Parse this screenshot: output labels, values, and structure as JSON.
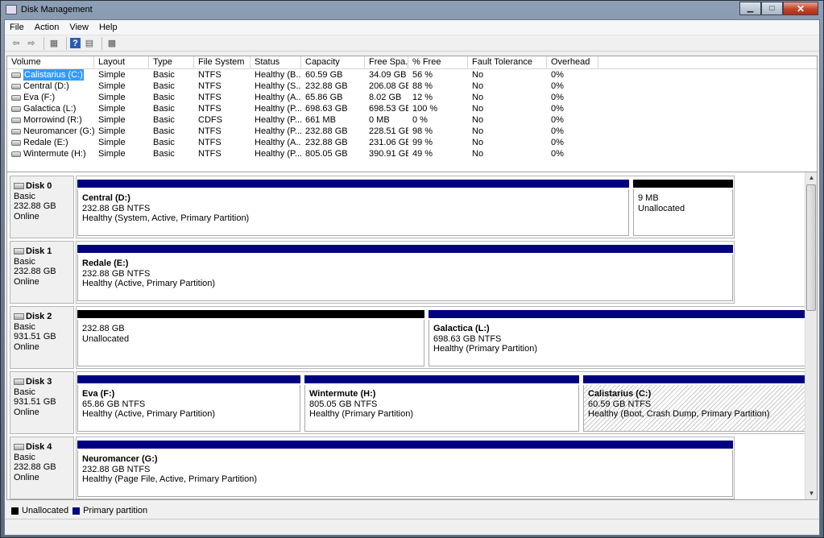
{
  "window": {
    "title": "Disk Management"
  },
  "menu": [
    "File",
    "Action",
    "View",
    "Help"
  ],
  "toolbar": {
    "icons": [
      "back-arrow-icon",
      "forward-arrow-icon",
      "properties-icon",
      "help-icon",
      "settings-icon"
    ]
  },
  "volume_list": {
    "headers": [
      "Volume",
      "Layout",
      "Type",
      "File System",
      "Status",
      "Capacity",
      "Free Spa...",
      "% Free",
      "Fault Tolerance",
      "Overhead"
    ],
    "rows": [
      {
        "volume": "Calistarius (C:)",
        "layout": "Simple",
        "type": "Basic",
        "fs": "NTFS",
        "status": "Healthy (B...",
        "capacity": "60.59 GB",
        "free": "34.09 GB",
        "pct": "56 %",
        "fault": "No",
        "overhead": "0%"
      },
      {
        "volume": "Central (D:)",
        "layout": "Simple",
        "type": "Basic",
        "fs": "NTFS",
        "status": "Healthy (S...",
        "capacity": "232.88 GB",
        "free": "206.08 GB",
        "pct": "88 %",
        "fault": "No",
        "overhead": "0%"
      },
      {
        "volume": "Eva (F:)",
        "layout": "Simple",
        "type": "Basic",
        "fs": "NTFS",
        "status": "Healthy (A...",
        "capacity": "65.86 GB",
        "free": "8.02 GB",
        "pct": "12 %",
        "fault": "No",
        "overhead": "0%"
      },
      {
        "volume": "Galactica (L:)",
        "layout": "Simple",
        "type": "Basic",
        "fs": "NTFS",
        "status": "Healthy (P...",
        "capacity": "698.63 GB",
        "free": "698.53 GB",
        "pct": "100 %",
        "fault": "No",
        "overhead": "0%"
      },
      {
        "volume": "Morrowind (R:)",
        "layout": "Simple",
        "type": "Basic",
        "fs": "CDFS",
        "status": "Healthy (P...",
        "capacity": "661 MB",
        "free": "0 MB",
        "pct": "0 %",
        "fault": "No",
        "overhead": "0%"
      },
      {
        "volume": "Neuromancer (G:)",
        "layout": "Simple",
        "type": "Basic",
        "fs": "NTFS",
        "status": "Healthy (P...",
        "capacity": "232.88 GB",
        "free": "228.51 GB",
        "pct": "98 %",
        "fault": "No",
        "overhead": "0%"
      },
      {
        "volume": "Redale (E:)",
        "layout": "Simple",
        "type": "Basic",
        "fs": "NTFS",
        "status": "Healthy (A...",
        "capacity": "232.88 GB",
        "free": "231.06 GB",
        "pct": "99 %",
        "fault": "No",
        "overhead": "0%"
      },
      {
        "volume": "Wintermute (H:)",
        "layout": "Simple",
        "type": "Basic",
        "fs": "NTFS",
        "status": "Healthy (P...",
        "capacity": "805.05 GB",
        "free": "390.91 GB",
        "pct": "49 %",
        "fault": "No",
        "overhead": "0%"
      }
    ]
  },
  "disks": [
    {
      "name": "Disk 0",
      "type": "Basic",
      "size": "232.88 GB",
      "status": "Online",
      "partitions": [
        {
          "kind": "primary",
          "name": "Central  (D:)",
          "line2": "232.88 GB NTFS",
          "line3": "Healthy (System, Active, Primary Partition)"
        },
        {
          "kind": "unallocated",
          "name": "",
          "line2": "9 MB",
          "line3": "Unallocated"
        }
      ]
    },
    {
      "name": "Disk 1",
      "type": "Basic",
      "size": "232.88 GB",
      "status": "Online",
      "partitions": [
        {
          "kind": "primary",
          "name": "Redale  (E:)",
          "line2": "232.88 GB NTFS",
          "line3": "Healthy (Active, Primary Partition)"
        }
      ]
    },
    {
      "name": "Disk 2",
      "type": "Basic",
      "size": "931.51 GB",
      "status": "Online",
      "partitions": [
        {
          "kind": "unallocated",
          "name": "",
          "line2": "232.88 GB",
          "line3": "Unallocated"
        },
        {
          "kind": "primary",
          "name": "Galactica  (L:)",
          "line2": "698.63 GB NTFS",
          "line3": "Healthy (Primary Partition)"
        }
      ]
    },
    {
      "name": "Disk 3",
      "type": "Basic",
      "size": "931.51 GB",
      "status": "Online",
      "partitions": [
        {
          "kind": "primary",
          "name": "Eva  (F:)",
          "line2": "65.86 GB NTFS",
          "line3": "Healthy (Active, Primary Partition)"
        },
        {
          "kind": "primary",
          "name": "Wintermute  (H:)",
          "line2": "805.05 GB NTFS",
          "line3": "Healthy (Primary Partition)"
        },
        {
          "kind": "primary",
          "name": "Calistarius  (C:)",
          "line2": "60.59 GB NTFS",
          "line3": "Healthy (Boot, Crash Dump, Primary Partition)",
          "selected": true
        }
      ]
    },
    {
      "name": "Disk 4",
      "type": "Basic",
      "size": "232.88 GB",
      "status": "Online",
      "partitions": [
        {
          "kind": "primary",
          "name": "Neuromancer  (G:)",
          "line2": "232.88 GB NTFS",
          "line3": "Healthy (Page File, Active, Primary Partition)"
        }
      ]
    }
  ],
  "legend": [
    {
      "label": "Unallocated",
      "color": "#000000"
    },
    {
      "label": "Primary partition",
      "color": "#000080"
    }
  ]
}
